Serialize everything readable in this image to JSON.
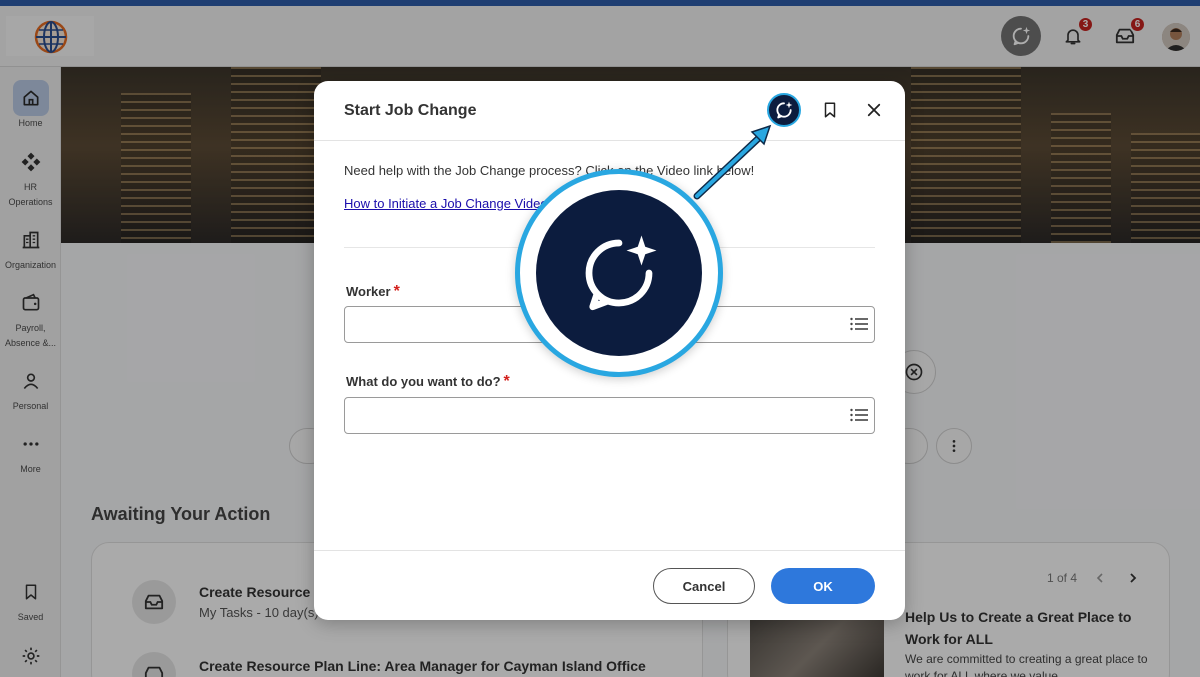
{
  "app": {
    "notifications_count": "3",
    "inbox_count": "6"
  },
  "sidebar": {
    "items": [
      {
        "label": "Home"
      },
      {
        "label": "HR Operations"
      },
      {
        "label": "Organization"
      },
      {
        "label": "Payroll, Absence &..."
      },
      {
        "label": "Personal"
      },
      {
        "label": "More"
      },
      {
        "label": "Saved"
      }
    ]
  },
  "dashboard": {
    "section_title": "Awaiting Your Action",
    "tasks": [
      {
        "title": "Create Resource",
        "subtitle": "My Tasks - 10 day(s)"
      },
      {
        "title": "Create Resource Plan Line: Area Manager for Cayman Island Office",
        "subtitle": ""
      }
    ],
    "pager": "1 of 4",
    "news": {
      "title": "Help Us to Create a Great Place to Work for ALL",
      "subtitle": "We are committed to creating a great place to work for ALL where we value"
    }
  },
  "modal": {
    "title": "Start Job Change",
    "help_text": "Need help with the Job Change process? Click on the Video link below!",
    "help_link": "How to Initiate a Job Change Video",
    "fields": [
      {
        "label": "Worker",
        "required": "*",
        "value": ""
      },
      {
        "label": "What do you want to do?",
        "required": "*",
        "value": ""
      }
    ],
    "cancel_label": "Cancel",
    "ok_label": "OK"
  },
  "colors": {
    "accent": "#2e78dc",
    "assistant_navy": "#0c1c3e",
    "highlight_blue": "#29a7e1",
    "required_red": "#d3201c",
    "badge_red": "#c4231f"
  },
  "icons": {
    "assistant": "chat-sparkle-icon",
    "bookmark": "bookmark-icon",
    "close": "close-icon",
    "prompt_list": "list-icon"
  }
}
